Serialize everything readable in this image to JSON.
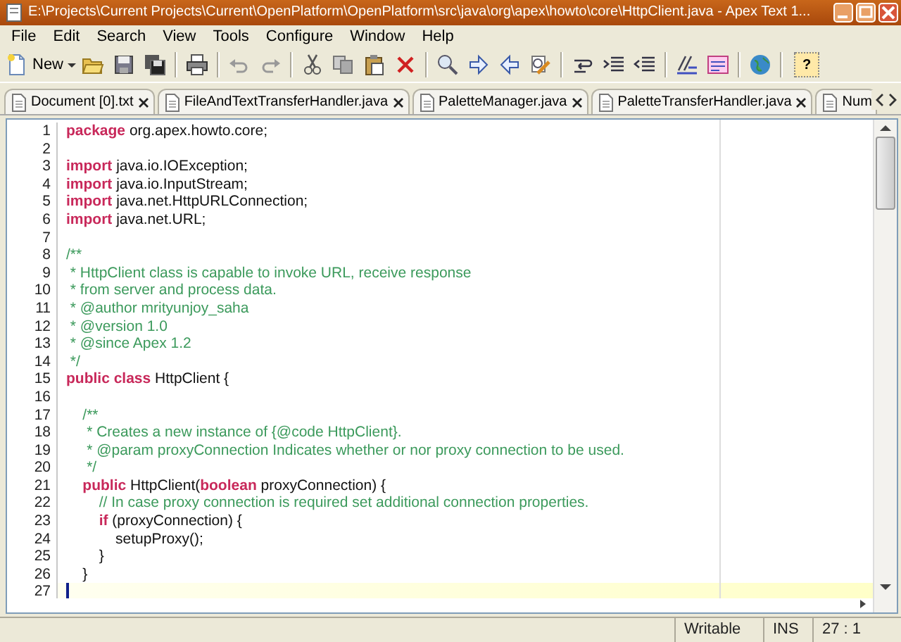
{
  "window": {
    "title": "E:\\Projects\\Current Projects\\Current\\OpenPlatform\\OpenPlatform\\src\\java\\org\\apex\\howto\\core\\HttpClient.java - Apex Text 1..."
  },
  "menu": [
    "File",
    "Edit",
    "Search",
    "View",
    "Tools",
    "Configure",
    "Window",
    "Help"
  ],
  "toolbar": {
    "new_label": "New",
    "help_label": "?"
  },
  "tabs": [
    {
      "label": "Document [0].txt",
      "selected": false
    },
    {
      "label": "FileAndTextTransferHandler.java",
      "selected": false
    },
    {
      "label": "PaletteManager.java",
      "selected": false
    },
    {
      "label": "PaletteTransferHandler.java",
      "selected": false
    },
    {
      "label": "Num",
      "selected": false
    }
  ],
  "code_lines": [
    {
      "number": "1",
      "current": false,
      "segments": [
        {
          "kind": "keyword",
          "text": "package"
        },
        {
          "kind": "plain",
          "text": " org.apex.howto.core;"
        }
      ]
    },
    {
      "number": "2",
      "current": false
    },
    {
      "number": "3",
      "current": false,
      "segments": [
        {
          "kind": "keyword",
          "text": "import"
        },
        {
          "kind": "plain",
          "text": " java.io.IOException;"
        }
      ]
    },
    {
      "number": "4",
      "current": false,
      "segments": [
        {
          "kind": "keyword",
          "text": "import"
        },
        {
          "kind": "plain",
          "text": " java.io.InputStream;"
        }
      ]
    },
    {
      "number": "5",
      "current": false,
      "segments": [
        {
          "kind": "keyword",
          "text": "import"
        },
        {
          "kind": "plain",
          "text": " java.net.HttpURLConnection;"
        }
      ]
    },
    {
      "number": "6",
      "current": false,
      "segments": [
        {
          "kind": "keyword",
          "text": "import"
        },
        {
          "kind": "plain",
          "text": " java.net.URL;"
        }
      ]
    },
    {
      "number": "7",
      "current": false
    },
    {
      "number": "8",
      "current": false,
      "segments": [
        {
          "kind": "comment",
          "text": "/**"
        }
      ]
    },
    {
      "number": "9",
      "current": false,
      "segments": [
        {
          "kind": "comment",
          "text": " * HttpClient class is capable to invoke URL, receive response"
        }
      ]
    },
    {
      "number": "10",
      "current": false,
      "segments": [
        {
          "kind": "comment",
          "text": " * from server and process data."
        }
      ]
    },
    {
      "number": "11",
      "current": false,
      "segments": [
        {
          "kind": "comment",
          "text": " * @author mrityunjoy_saha"
        }
      ]
    },
    {
      "number": "12",
      "current": false,
      "segments": [
        {
          "kind": "comment",
          "text": " * @version 1.0"
        }
      ]
    },
    {
      "number": "13",
      "current": false,
      "segments": [
        {
          "kind": "comment",
          "text": " * @since Apex 1.2"
        }
      ]
    },
    {
      "number": "14",
      "current": false,
      "segments": [
        {
          "kind": "comment",
          "text": " */"
        }
      ]
    },
    {
      "number": "15",
      "current": false,
      "segments": [
        {
          "kind": "keyword",
          "text": "public"
        },
        {
          "kind": "keyword",
          "text": " class"
        },
        {
          "kind": "plain",
          "text": " HttpClient {"
        }
      ]
    },
    {
      "number": "16",
      "current": false
    },
    {
      "number": "17",
      "current": false,
      "segments": [
        {
          "kind": "comment",
          "text": "    /**"
        }
      ]
    },
    {
      "number": "18",
      "current": false,
      "segments": [
        {
          "kind": "comment",
          "text": "     * Creates a new instance of {@code HttpClient}."
        }
      ]
    },
    {
      "number": "19",
      "current": false,
      "segments": [
        {
          "kind": "comment",
          "text": "     * @param proxyConnection Indicates whether or nor proxy connection to be used."
        }
      ]
    },
    {
      "number": "20",
      "current": false,
      "segments": [
        {
          "kind": "comment",
          "text": "     */"
        }
      ]
    },
    {
      "number": "21",
      "current": false,
      "segments": [
        {
          "kind": "keyword",
          "text": "    public"
        },
        {
          "kind": "plain",
          "text": " HttpClient("
        },
        {
          "kind": "keyword",
          "text": "boolean"
        },
        {
          "kind": "plain",
          "text": " proxyConnection) {"
        }
      ]
    },
    {
      "number": "22",
      "current": false,
      "segments": [
        {
          "kind": "comment",
          "text": "        // In case proxy connection is required set additional connection properties."
        }
      ]
    },
    {
      "number": "23",
      "current": false,
      "segments": [
        {
          "kind": "keyword",
          "text": "        if"
        },
        {
          "kind": "plain",
          "text": " (proxyConnection) {"
        }
      ]
    },
    {
      "number": "24",
      "current": false,
      "segments": [
        {
          "kind": "plain",
          "text": "            setupProxy();"
        }
      ]
    },
    {
      "number": "25",
      "current": false,
      "segments": [
        {
          "kind": "plain",
          "text": "        }"
        }
      ]
    },
    {
      "number": "26",
      "current": false,
      "segments": [
        {
          "kind": "plain",
          "text": "    }"
        }
      ]
    },
    {
      "number": "27",
      "current": true
    }
  ],
  "status_bar": {
    "mode": "Writable",
    "insert": "INS",
    "position": "27 : 1"
  }
}
